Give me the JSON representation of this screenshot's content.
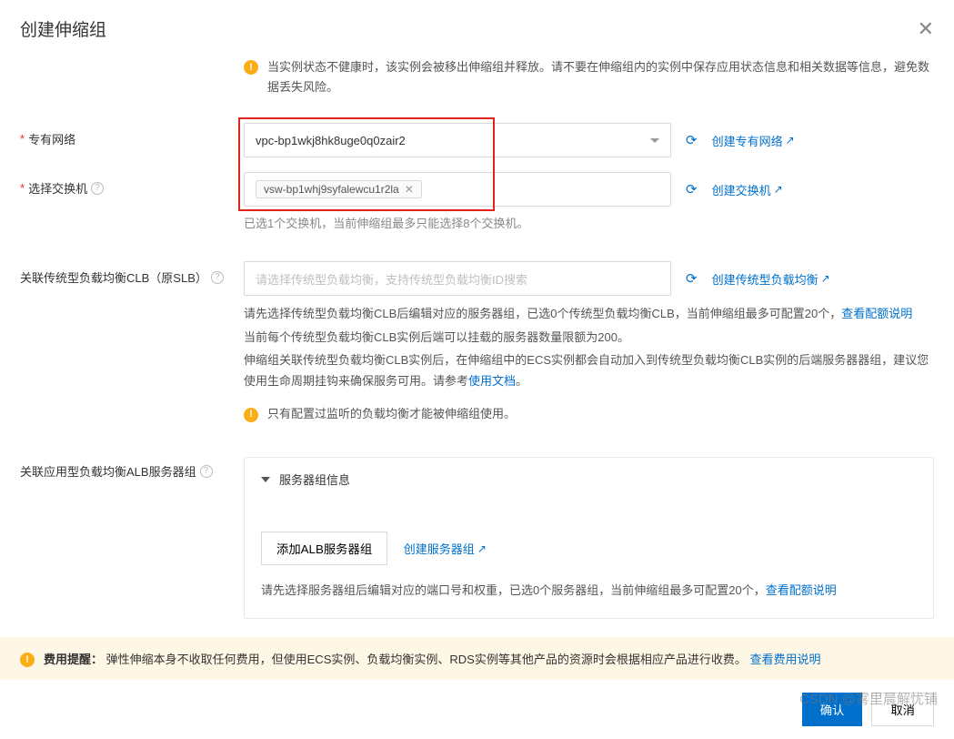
{
  "dialog": {
    "title": "创建伸缩组",
    "warning": "当实例状态不健康时，该实例会被移出伸缩组并释放。请不要在伸缩组内的实例中保存应用状态信息和相关数据等信息，避免数据丢失风险。"
  },
  "vpc": {
    "label": "专有网络",
    "value": "vpc-bp1wkj8hk8uge0q0zair2",
    "create_link": "创建专有网络"
  },
  "vswitch": {
    "label": "选择交换机",
    "tag_value": "vsw-bp1whj9syfalewcu1r2la",
    "hint": "已选1个交换机，当前伸缩组最多只能选择8个交换机。",
    "create_link": "创建交换机"
  },
  "clb": {
    "label": "关联传统型负载均衡CLB（原SLB）",
    "placeholder": "请选择传统型负载均衡，支持传统型负载均衡ID搜索",
    "create_link": "创建传统型负载均衡",
    "desc1_prefix": "请先选择传统型负载均衡CLB后编辑对应的服务器组，已选0个传统型负载均衡CLB，当前伸缩组最多可配置20个，",
    "quota_link": "查看配额说明",
    "desc2": "当前每个传统型负载均衡CLB实例后端可以挂载的服务器数量限额为200。",
    "desc3_prefix": "伸缩组关联传统型负载均衡CLB实例后，在伸缩组中的ECS实例都会自动加入到传统型负载均衡CLB实例的后端服务器器组，建议您使用生命周期挂钩来确保服务可用。请参考",
    "doc_link": "使用文档",
    "warn": "只有配置过监听的负载均衡才能被伸缩组使用。"
  },
  "alb": {
    "label": "关联应用型负载均衡ALB服务器组",
    "panel_title": "服务器组信息",
    "add_btn": "添加ALB服务器组",
    "create_link": "创建服务器组",
    "desc_prefix": "请先选择服务器组后编辑对应的端口号和权重，已选0个服务器组，当前伸缩组最多可配置20个，",
    "quota_link": "查看配额说明"
  },
  "fee": {
    "label": "费用提醒：",
    "text": "弹性伸缩本身不收取任何费用，但使用ECS实例、负载均衡实例、RDS实例等其他产品的资源时会根据相应产品进行收费。",
    "link": "查看费用说明"
  },
  "footer": {
    "confirm": "确认",
    "cancel": "取消"
  },
  "watermark": "CSDN @雾里晨解忧铺"
}
